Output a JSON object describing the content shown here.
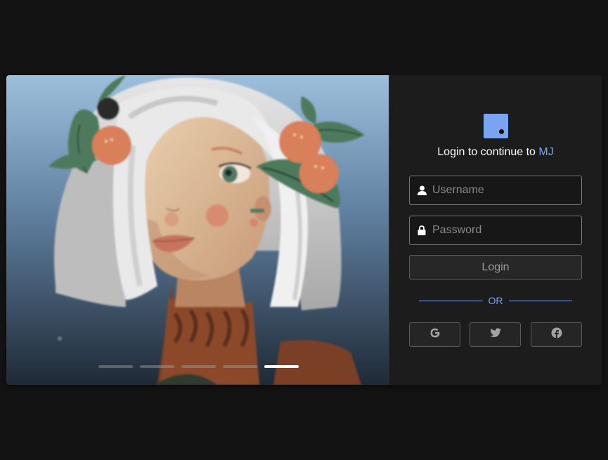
{
  "login": {
    "heading_prefix": "Login to continue to ",
    "brand": "MJ",
    "username_placeholder": "Username",
    "username_value": "",
    "password_placeholder": "Password",
    "password_value": "",
    "login_button": "Login",
    "separator": "OR",
    "social": [
      {
        "provider": "google",
        "icon": "google-icon"
      },
      {
        "provider": "twitter",
        "icon": "twitter-icon"
      },
      {
        "provider": "facebook",
        "icon": "facebook-icon"
      }
    ]
  },
  "carousel": {
    "slide_count": 5,
    "active_index": 4
  },
  "colors": {
    "accent": "#7aa3f0",
    "page_bg": "#131313",
    "panel_bg": "#1c1c1c"
  }
}
